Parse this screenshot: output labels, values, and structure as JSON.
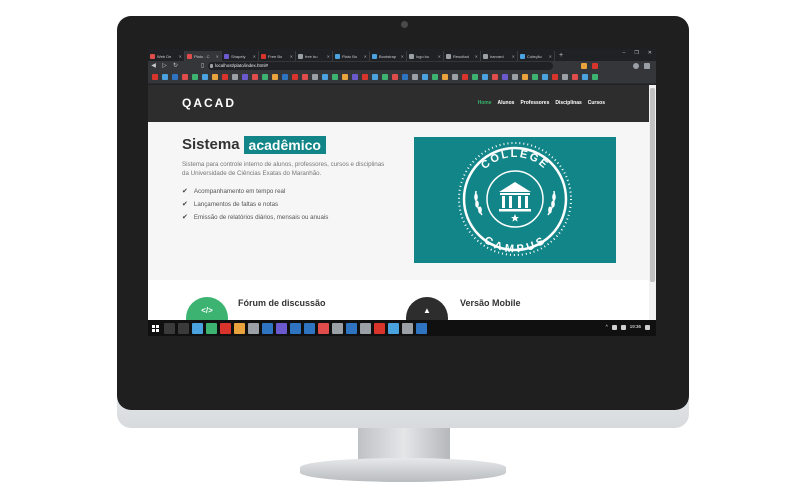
{
  "browser": {
    "tabs": [
      {
        "title": "Web De",
        "color": "#e04b4b",
        "active": false
      },
      {
        "title": "Plato - C",
        "color": "#e04b4b",
        "active": true
      },
      {
        "title": "Shapely",
        "color": "#6a5acd",
        "active": false
      },
      {
        "title": "Free Bo",
        "color": "#d9342b",
        "active": false
      },
      {
        "title": "free bu",
        "color": "#9aa0a6",
        "active": false
      },
      {
        "title": "Plato Bo",
        "color": "#4aa3df",
        "active": false
      },
      {
        "title": "Bootstrap",
        "color": "#4aa3df",
        "active": false
      },
      {
        "title": "logo bu",
        "color": "#9aa0a6",
        "active": false
      },
      {
        "title": "Resultad",
        "color": "#9aa0a6",
        "active": false
      },
      {
        "title": "harvard",
        "color": "#9aa0a6",
        "active": false
      },
      {
        "title": "Coleção",
        "color": "#4aa3df",
        "active": false
      }
    ],
    "new_tab": "+",
    "url": "localhost/plato/index.html#",
    "window_controls": [
      "–",
      "❐",
      "✕"
    ]
  },
  "bookmarks": [
    "#d9342b",
    "#4aa3df",
    "#2f74c0",
    "#e04b4b",
    "#3cb371",
    "#4aa3df",
    "#e8a33d",
    "#d9342b",
    "#9aa0a6",
    "#6a5acd",
    "#e04b4b",
    "#3cb371",
    "#e8a33d",
    "#2f74c0",
    "#d9342b",
    "#e04b4b",
    "#9aa0a6",
    "#4aa3df",
    "#3cb371",
    "#e8a33d",
    "#6a5acd",
    "#d9342b",
    "#4aa3df",
    "#3cb371",
    "#e04b4b",
    "#2f74c0",
    "#9aa0a6",
    "#4aa3df",
    "#3cb371",
    "#e8a33d",
    "#9aa0a6",
    "#d9342b",
    "#3cb371",
    "#4aa3df",
    "#e04b4b",
    "#6a5acd",
    "#9aa0a6",
    "#e8a33d",
    "#3cb371",
    "#4aa3df",
    "#d9342b",
    "#9aa0a6",
    "#e04b4b",
    "#4aa3df",
    "#3cb371"
  ],
  "site": {
    "brand": "QACAD",
    "menu": [
      {
        "label": "Home",
        "active": true
      },
      {
        "label": "Alunos",
        "active": false
      },
      {
        "label": "Professores",
        "active": false
      },
      {
        "label": "Disciplinas",
        "active": false
      },
      {
        "label": "Cursos",
        "active": false
      }
    ],
    "hero": {
      "title_plain": "Sistema",
      "title_highlight": "acadêmico",
      "description": "Sistema para controle interno de alunos, professores, cursos e disciplinas da Universidade de Ciências Exatas do Maranhão.",
      "features": [
        "Acompanhamento em tempo real",
        "Lançamentos de faltas e notas",
        "Emissão de relatórios diários, mensais ou anuais"
      ],
      "check_icon": "check-icon",
      "badge": {
        "top": "COLLEGE",
        "bottom": "CAMPUS",
        "background": "#128588"
      }
    },
    "sections": [
      {
        "title": "Fórum de discussão",
        "icon": "code-icon",
        "icon_glyph": "</>",
        "color": "#3cb371"
      },
      {
        "title": "Versão Mobile",
        "icon": "android-icon",
        "icon_glyph": "▲",
        "color": "#2d2d2d"
      }
    ]
  },
  "taskbar": {
    "icons": [
      "#3a3a3a",
      "#3a3a3a",
      "#4aa3df",
      "#3cb371",
      "#d9342b",
      "#e8a33d",
      "#9aa0a6",
      "#2f74c0",
      "#6a5acd",
      "#2f74c0",
      "#2f74c0",
      "#e04b4b",
      "#9aa0a6",
      "#2f74c0",
      "#9aa0a6",
      "#d9342b",
      "#4aa3df",
      "#9aa0a6",
      "#2f74c0"
    ],
    "time": "19:36"
  },
  "colors": {
    "accent": "#128588",
    "nav_active": "#38b36b",
    "nav_bg": "#2d2d2d"
  }
}
